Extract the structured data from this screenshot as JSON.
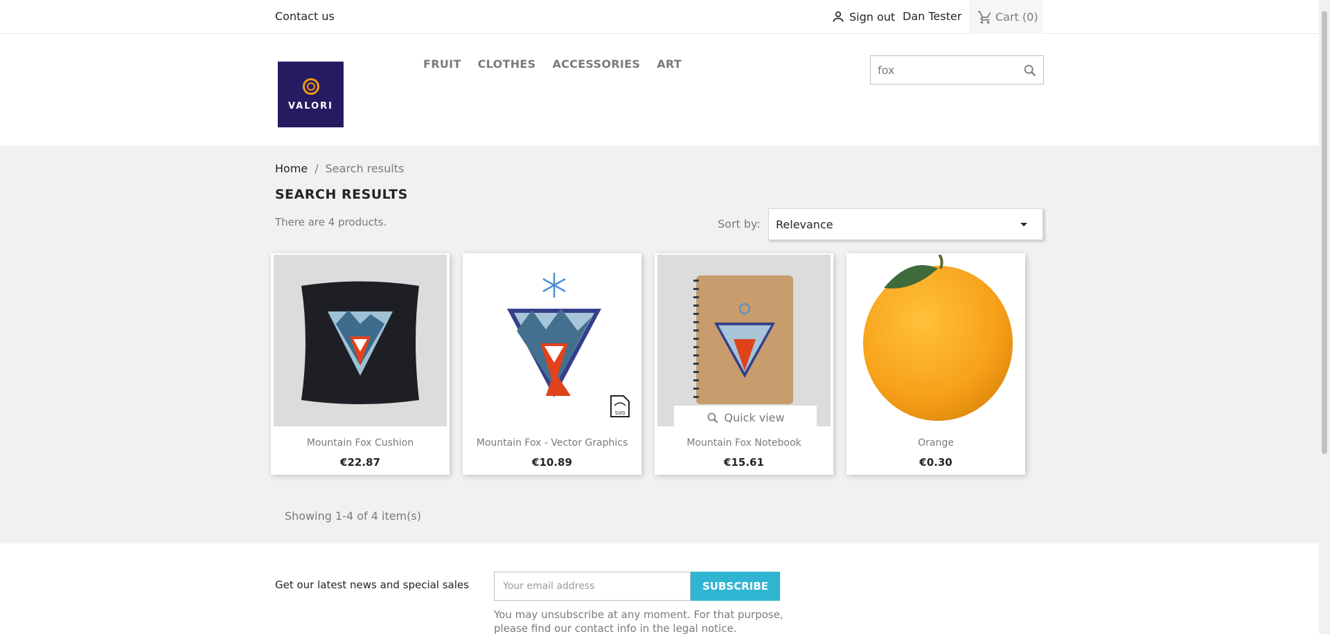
{
  "topbar": {
    "contact_label": "Contact us",
    "signout_label": "Sign out",
    "user_name": "Dan Tester",
    "cart_label": "Cart (0)"
  },
  "header": {
    "logo_text": "VALORI",
    "nav": [
      "FRUIT",
      "CLOTHES",
      "ACCESSORIES",
      "ART"
    ],
    "search_value": "fox"
  },
  "breadcrumb": {
    "home": "Home",
    "separator": "/",
    "current": "Search results"
  },
  "page": {
    "title": "SEARCH RESULTS",
    "count_text": "There are 4 products.",
    "sort_label": "Sort by:",
    "sort_value": "Relevance",
    "showing_text": "Showing 1-4 of 4 item(s)"
  },
  "products": [
    {
      "name": "Mountain Fox Cushion",
      "price": "€22.87"
    },
    {
      "name": "Mountain Fox - Vector Graphics",
      "price": "€10.89"
    },
    {
      "name": "Mountain Fox Notebook",
      "price": "€15.61",
      "quick_view": "Quick view"
    },
    {
      "name": "Orange",
      "price": "€0.30"
    }
  ],
  "newsletter": {
    "text": "Get our latest news and special sales",
    "placeholder": "Your email address",
    "button": "SUBSCRIBE",
    "note": "You may unsubscribe at any moment. For that purpose, please find our contact info in the legal notice."
  },
  "colors": {
    "accent": "#2fb5d2",
    "logo_bg": "#241b61",
    "logo_mark": "#f39c12",
    "page_bg": "#f1f1f1"
  }
}
